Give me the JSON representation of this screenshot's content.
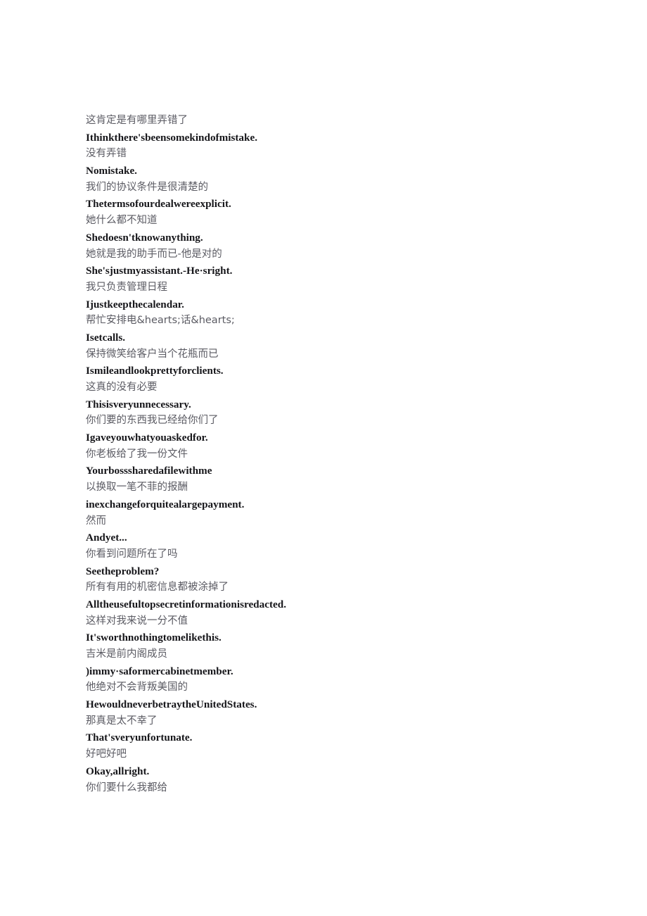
{
  "document": {
    "background_color": "#ffffff",
    "zh_text_color": "#5b5b63",
    "en_text_color": "#16161a",
    "lines": [
      {
        "lang": "zh",
        "text": "这肯定是有哪里弄错了"
      },
      {
        "lang": "en",
        "text": "Ithinkthere'sbeensomekindofmistake."
      },
      {
        "lang": "zh",
        "text": "没有弄错"
      },
      {
        "lang": "en",
        "text": "Nomistake."
      },
      {
        "lang": "zh",
        "text": "我们的协议条件是很清楚的"
      },
      {
        "lang": "en",
        "text": "Thetermsofourdealwereexplicit."
      },
      {
        "lang": "zh",
        "text": "她什么都不知道"
      },
      {
        "lang": "en",
        "text": "Shedoesn'tknowanything."
      },
      {
        "lang": "zh",
        "text": "她就是我的助手而已-他是对的"
      },
      {
        "lang": "en",
        "text": "She'sjustmyassistant.-He·sright."
      },
      {
        "lang": "zh",
        "text": "我只负责管理日程"
      },
      {
        "lang": "en",
        "text": "Ijustkeepthecalendar."
      },
      {
        "lang": "zh",
        "text": "帮忙安排电&hearts;话&hearts;"
      },
      {
        "lang": "en",
        "text": "Isetcalls."
      },
      {
        "lang": "zh",
        "text": "保持微笑给客户当个花瓶而已"
      },
      {
        "lang": "en",
        "text": "Ismileandlookprettyforclients."
      },
      {
        "lang": "zh",
        "text": "这真的没有必要"
      },
      {
        "lang": "en",
        "text": "Thisisveryunnecessary."
      },
      {
        "lang": "zh",
        "text": "你们要的东西我已经给你们了"
      },
      {
        "lang": "en",
        "text": "Igaveyouwhatyouaskedfor."
      },
      {
        "lang": "zh",
        "text": "你老板给了我一份文件"
      },
      {
        "lang": "en",
        "text": "Yourbosssharedafilewithme"
      },
      {
        "lang": "zh",
        "text": "以换取一笔不菲的报酬"
      },
      {
        "lang": "en",
        "text": "inexchangeforquitealargepayment."
      },
      {
        "lang": "zh",
        "text": "然而"
      },
      {
        "lang": "en",
        "text": "Andyet..."
      },
      {
        "lang": "zh",
        "text": "你看到问题所在了吗"
      },
      {
        "lang": "en",
        "text": "Seetheproblem?"
      },
      {
        "lang": "zh",
        "text": "所有有用的机密信息都被涂掉了"
      },
      {
        "lang": "en",
        "text": "Alltheusefultopsecretinformationisredacted."
      },
      {
        "lang": "zh",
        "text": "这样对我来说一分不值"
      },
      {
        "lang": "en",
        "text": "It'sworthnothingtomelikethis."
      },
      {
        "lang": "zh",
        "text": "吉米是前内阁成员"
      },
      {
        "lang": "en",
        "text": ")immy·saformercabinetmember."
      },
      {
        "lang": "zh",
        "text": "他绝对不会背叛美国的"
      },
      {
        "lang": "en",
        "text": "HewouldneverbetraytheUnitedStates."
      },
      {
        "lang": "zh",
        "text": "那真是太不幸了"
      },
      {
        "lang": "en",
        "text": "That'sveryunfortunate."
      },
      {
        "lang": "zh",
        "text": "好吧好吧"
      },
      {
        "lang": "en",
        "text": "Okay,allright."
      },
      {
        "lang": "zh",
        "text": "你们要什么我都给"
      }
    ]
  }
}
